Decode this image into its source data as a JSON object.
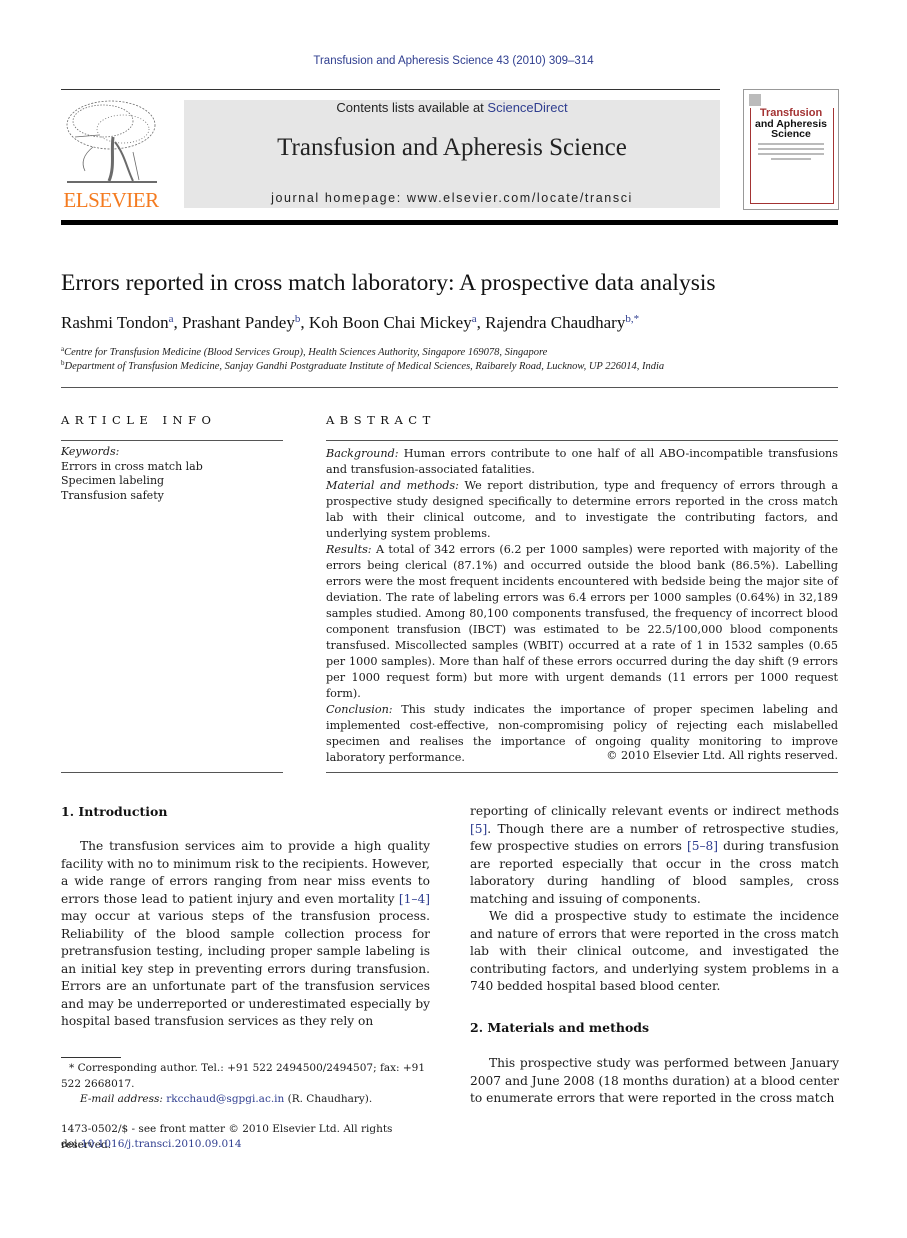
{
  "header": {
    "running_head": "Transfusion and Apheresis Science 43 (2010) 309–314",
    "publisher_logo_text": "ELSEVIER",
    "contents_prefix": "Contents lists available at ",
    "contents_link": "ScienceDirect",
    "journal_title": "Transfusion and Apheresis Science",
    "homepage": "journal homepage: www.elsevier.com/locate/transci",
    "cover": {
      "title_line1": "Transfusion",
      "title_line2": "and Apheresis",
      "title_line3": "Science"
    }
  },
  "article": {
    "title": "Errors reported in cross match laboratory: A prospective data analysis",
    "authors": [
      {
        "name": "Rashmi Tondon",
        "sup": "a"
      },
      {
        "name": "Prashant Pandey",
        "sup": "b"
      },
      {
        "name": "Koh Boon Chai Mickey",
        "sup": "a"
      },
      {
        "name": "Rajendra Chaudhary",
        "sup": "b,*"
      }
    ],
    "affiliations": [
      {
        "mark": "a",
        "text": "Centre for Transfusion Medicine (Blood Services Group), Health Sciences Authority, Singapore 169078, Singapore"
      },
      {
        "mark": "b",
        "text": "Department of Transfusion Medicine, Sanjay Gandhi Postgraduate Institute of Medical Sciences, Raibarely Road, Lucknow, UP 226014, India"
      }
    ]
  },
  "article_info": {
    "heading": "ARTICLE INFO",
    "keywords_label": "Keywords:",
    "keywords": [
      "Errors in cross match lab",
      "Specimen labeling",
      "Transfusion safety"
    ]
  },
  "abstract": {
    "heading": "ABSTRACT",
    "sections": [
      {
        "label": "Background:",
        "text": " Human errors contribute to one half of all ABO-incompatible transfusions and transfusion-associated fatalities."
      },
      {
        "label": "Material and methods:",
        "text": " We report distribution, type and frequency of errors through a prospective study designed specifically to determine errors reported in the cross match lab with their clinical outcome, and to investigate the contributing factors, and underlying system problems."
      },
      {
        "label": "Results:",
        "text": " A total of 342 errors (6.2 per 1000 samples) were reported with majority of the errors being clerical (87.1%) and occurred outside the blood bank (86.5%). Labelling errors were the most frequent incidents encountered with bedside being the major site of deviation. The rate of labeling errors was 6.4 errors per 1000 samples (0.64%) in 32,189 samples studied. Among 80,100 components transfused, the frequency of incorrect blood component transfusion (IBCT) was estimated to be 22.5/100,000 blood components transfused. Miscollected samples (WBIT) occurred at a rate of 1 in 1532 samples (0.65 per 1000 samples). More than half of these errors occurred during the day shift (9 errors per 1000 request form) but more with urgent demands (11 errors per 1000 request form)."
      },
      {
        "label": "Conclusion:",
        "text": " This study indicates the importance of proper specimen labeling and implemented cost-effective, non-compromising policy of rejecting each mislabelled specimen and realises the importance of ongoing quality monitoring to improve laboratory performance."
      }
    ],
    "copyright": "© 2010 Elsevier Ltd. All rights reserved."
  },
  "body": {
    "intro_heading": "1. Introduction",
    "intro_p1_a": "The transfusion services aim to provide a high quality facility with no to minimum risk to the recipients. However, a wide range of errors ranging from near miss events to errors those lead to patient injury and even mortality ",
    "intro_p1_ref": "[1–4]",
    "intro_p1_b": " may occur at various steps of the transfusion process. Reliability of the blood sample collection process for pretransfusion testing, including proper sample labeling is an initial key step in preventing errors during transfusion. Errors are an unfortunate part of the transfusion services and may be underreported or underestimated especially by hospital based transfusion services as they rely on",
    "intro_p1_c": "reporting of clinically relevant events or indirect methods ",
    "intro_p1_ref2": "[5]",
    "intro_p1_d": ". Though there are a number of retrospective studies, few prospective studies on errors ",
    "intro_p1_ref3": "[5–8]",
    "intro_p1_e": " during transfusion are reported especially that occur in the cross match laboratory during handling of blood samples, cross matching and issuing of components.",
    "intro_p2": "We did a prospective study to estimate the incidence and nature of errors that were reported in the cross match lab with their clinical outcome, and investigated the contributing factors, and underlying system problems in a 740 bedded hospital based blood center.",
    "methods_heading": "2. Materials and methods",
    "methods_p1": "This prospective study was performed between January 2007 and June 2008 (18 months duration) at a blood center to enumerate errors that were reported in the cross match"
  },
  "footnotes": {
    "corresponding": "* Corresponding author. Tel.: +91 522 2494500/2494507; fax: +91 522 2668017.",
    "email_label": "E-mail address:",
    "email": "rkcchaud@sgpgi.ac.in",
    "email_suffix": " (R. Chaudhary).",
    "front_matter": "1473-0502/$ - see front matter © 2010 Elsevier Ltd. All rights reserved.",
    "doi_prefix": "doi:",
    "doi": "10.1016/j.transci.2010.09.014"
  },
  "colors": {
    "link": "#2e3d8f",
    "elsevier_orange": "#f47b20",
    "banner_bg": "#e6e6e6",
    "cover_red": "#a33333"
  }
}
